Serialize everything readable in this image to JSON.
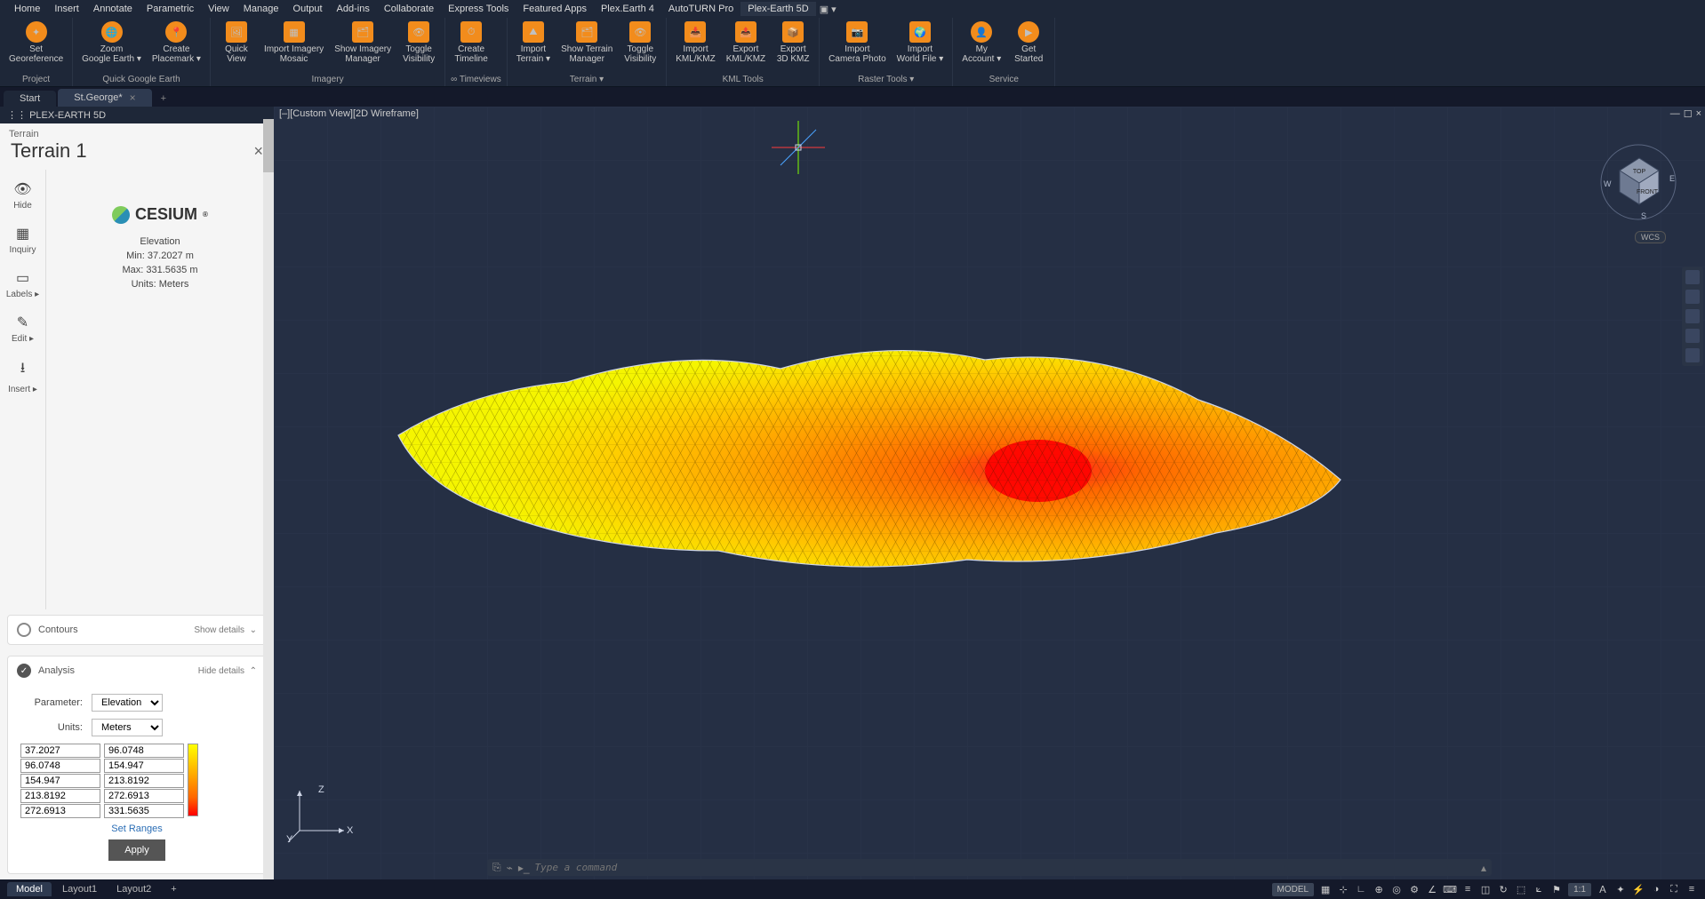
{
  "menubar": {
    "items": [
      "Home",
      "Insert",
      "Annotate",
      "Parametric",
      "View",
      "Manage",
      "Output",
      "Add-ins",
      "Collaborate",
      "Express Tools",
      "Featured Apps",
      "Plex.Earth 4",
      "AutoTURN Pro",
      "Plex-Earth 5D"
    ]
  },
  "ribbon": {
    "groups": [
      {
        "title": "Project",
        "buttons": [
          {
            "label": "Set\nGeoreference"
          }
        ]
      },
      {
        "title": "Quick Google Earth",
        "buttons": [
          {
            "label": "Zoom\nGoogle Earth ▾"
          },
          {
            "label": "Create\nPlacemark ▾"
          }
        ]
      },
      {
        "title": "Imagery",
        "buttons": [
          {
            "label": "Quick\nView"
          },
          {
            "label": "Import Imagery\nMosaic"
          },
          {
            "label": "Show Imagery\nManager"
          },
          {
            "label": "Toggle\nVisibility"
          }
        ]
      },
      {
        "title": "∞ Timeviews",
        "buttons": [
          {
            "label": "Create\nTimeline"
          }
        ]
      },
      {
        "title": "Terrain ▾",
        "buttons": [
          {
            "label": "Import\nTerrain ▾"
          },
          {
            "label": "Show Terrain\nManager"
          },
          {
            "label": "Toggle\nVisibility"
          }
        ]
      },
      {
        "title": "KML Tools",
        "buttons": [
          {
            "label": "Import\nKML/KMZ"
          },
          {
            "label": "Export\nKML/KMZ"
          },
          {
            "label": "Export\n3D KMZ"
          }
        ]
      },
      {
        "title": "Raster Tools ▾",
        "buttons": [
          {
            "label": "Import\nCamera Photo"
          },
          {
            "label": "Import\nWorld File ▾"
          }
        ]
      },
      {
        "title": "Service",
        "buttons": [
          {
            "label": "My\nAccount ▾"
          },
          {
            "label": "Get\nStarted"
          }
        ]
      }
    ]
  },
  "doctabs": {
    "items": [
      {
        "label": "Start",
        "active": false
      },
      {
        "label": "St.George*",
        "active": true
      }
    ]
  },
  "panel": {
    "header": "PLEX-EARTH 5D",
    "crumb": "Terrain",
    "title": "Terrain 1",
    "tools": [
      {
        "icon": "👁",
        "label": "Hide"
      },
      {
        "icon": "▦",
        "label": "Inquiry"
      },
      {
        "icon": "▭",
        "label": "Labels ▸"
      },
      {
        "icon": "✎",
        "label": "Edit ▸"
      },
      {
        "icon": "⭳",
        "label": "Insert ▸"
      }
    ],
    "provider": "CESIUM",
    "info": {
      "heading": "Elevation",
      "min": "Min: 37.2027 m",
      "max": "Max: 331.5635 m",
      "units": "Units: Meters"
    },
    "contours": {
      "label": "Contours",
      "toggle": "Show details"
    },
    "analysis": {
      "label": "Analysis",
      "toggle": "Hide details",
      "param_label": "Parameter:",
      "param_value": "Elevation",
      "units_label": "Units:",
      "units_value": "Meters",
      "ranges_from": [
        "37.2027",
        "96.0748",
        "154.947",
        "213.8192",
        "272.6913"
      ],
      "ranges_to": [
        "96.0748",
        "154.947",
        "213.8192",
        "272.6913",
        "331.5635"
      ],
      "set_ranges": "Set Ranges",
      "apply": "Apply"
    }
  },
  "viewport": {
    "label": "[–][Custom View][2D Wireframe]",
    "wcs": "WCS",
    "cube": {
      "top": "TOP",
      "front": "FRONT",
      "w": "W",
      "s": "S",
      "e": "E"
    },
    "axes": {
      "x": "X",
      "y": "Y",
      "z": "Z"
    },
    "cmd_placeholder": "Type a command"
  },
  "bottom": {
    "tabs": [
      {
        "label": "Model",
        "active": true
      },
      {
        "label": "Layout1",
        "active": false
      },
      {
        "label": "Layout2",
        "active": false
      }
    ],
    "status": {
      "model": "MODEL",
      "scale": "1:1"
    }
  }
}
